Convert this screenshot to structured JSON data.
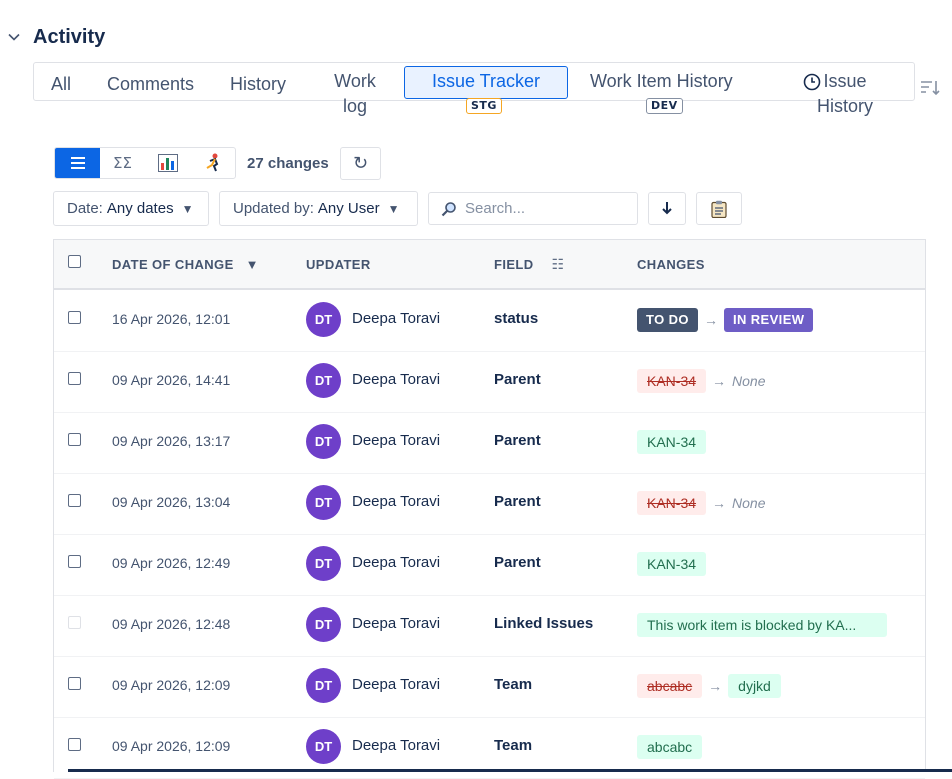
{
  "activity": {
    "title": "Activity"
  },
  "tabs": [
    {
      "label": "All"
    },
    {
      "label": "Comments"
    },
    {
      "label": "History"
    },
    {
      "label": "Work log"
    },
    {
      "label": "Issue Tracker",
      "badge": "STG",
      "active": true
    },
    {
      "label": "Work Item History",
      "badge": "DEV"
    },
    {
      "label": "Issue History",
      "icon": "clock-icon"
    }
  ],
  "toolbar": {
    "views": [
      "list-icon",
      "sigma-icon",
      "bar-chart-icon",
      "runner-icon"
    ],
    "changes_count": "27 changes",
    "refresh_icon": "↻"
  },
  "filters": {
    "date": {
      "label": "Date:",
      "value": "Any dates"
    },
    "updated_by": {
      "label": "Updated by:",
      "value": "Any User"
    },
    "search_placeholder": "Search..."
  },
  "table": {
    "headers": {
      "date": "DATE OF CHANGE",
      "updater": "UPDATER",
      "field": "FIELD",
      "changes": "CHANGES"
    },
    "rows": [
      {
        "date": "16 Apr 2026, 12:01",
        "initials": "DT",
        "updater": "Deepa Toravi",
        "field": "status",
        "from": "TO DO",
        "to": "IN REVIEW",
        "kind": "status"
      },
      {
        "date": "09 Apr 2026, 14:41",
        "initials": "DT",
        "updater": "Deepa Toravi",
        "field": "Parent",
        "from": "KAN-34",
        "to": "None",
        "kind": "removed"
      },
      {
        "date": "09 Apr 2026, 13:17",
        "initials": "DT",
        "updater": "Deepa Toravi",
        "field": "Parent",
        "to": "KAN-34",
        "kind": "added"
      },
      {
        "date": "09 Apr 2026, 13:04",
        "initials": "DT",
        "updater": "Deepa Toravi",
        "field": "Parent",
        "from": "KAN-34",
        "to": "None",
        "kind": "removed"
      },
      {
        "date": "09 Apr 2026, 12:49",
        "initials": "DT",
        "updater": "Deepa Toravi",
        "field": "Parent",
        "to": "KAN-34",
        "kind": "added"
      },
      {
        "date": "09 Apr 2026, 12:48",
        "initials": "DT",
        "updater": "Deepa Toravi",
        "field": "Linked Issues",
        "to": "This work item is blocked by KA...",
        "kind": "added-long"
      },
      {
        "date": "09 Apr 2026, 12:09",
        "initials": "DT",
        "updater": "Deepa Toravi",
        "field": "Team",
        "from": "abcabc",
        "to": "dyjkd",
        "kind": "replaced"
      },
      {
        "date": "09 Apr 2026, 12:09",
        "initials": "DT",
        "updater": "Deepa Toravi",
        "field": "Team",
        "to": "abcabc",
        "kind": "added"
      }
    ]
  },
  "colors": {
    "accent": "#0c66e4",
    "avatar": "#6e3fc9",
    "todo": "#44546f",
    "review": "#6e5dc6"
  }
}
